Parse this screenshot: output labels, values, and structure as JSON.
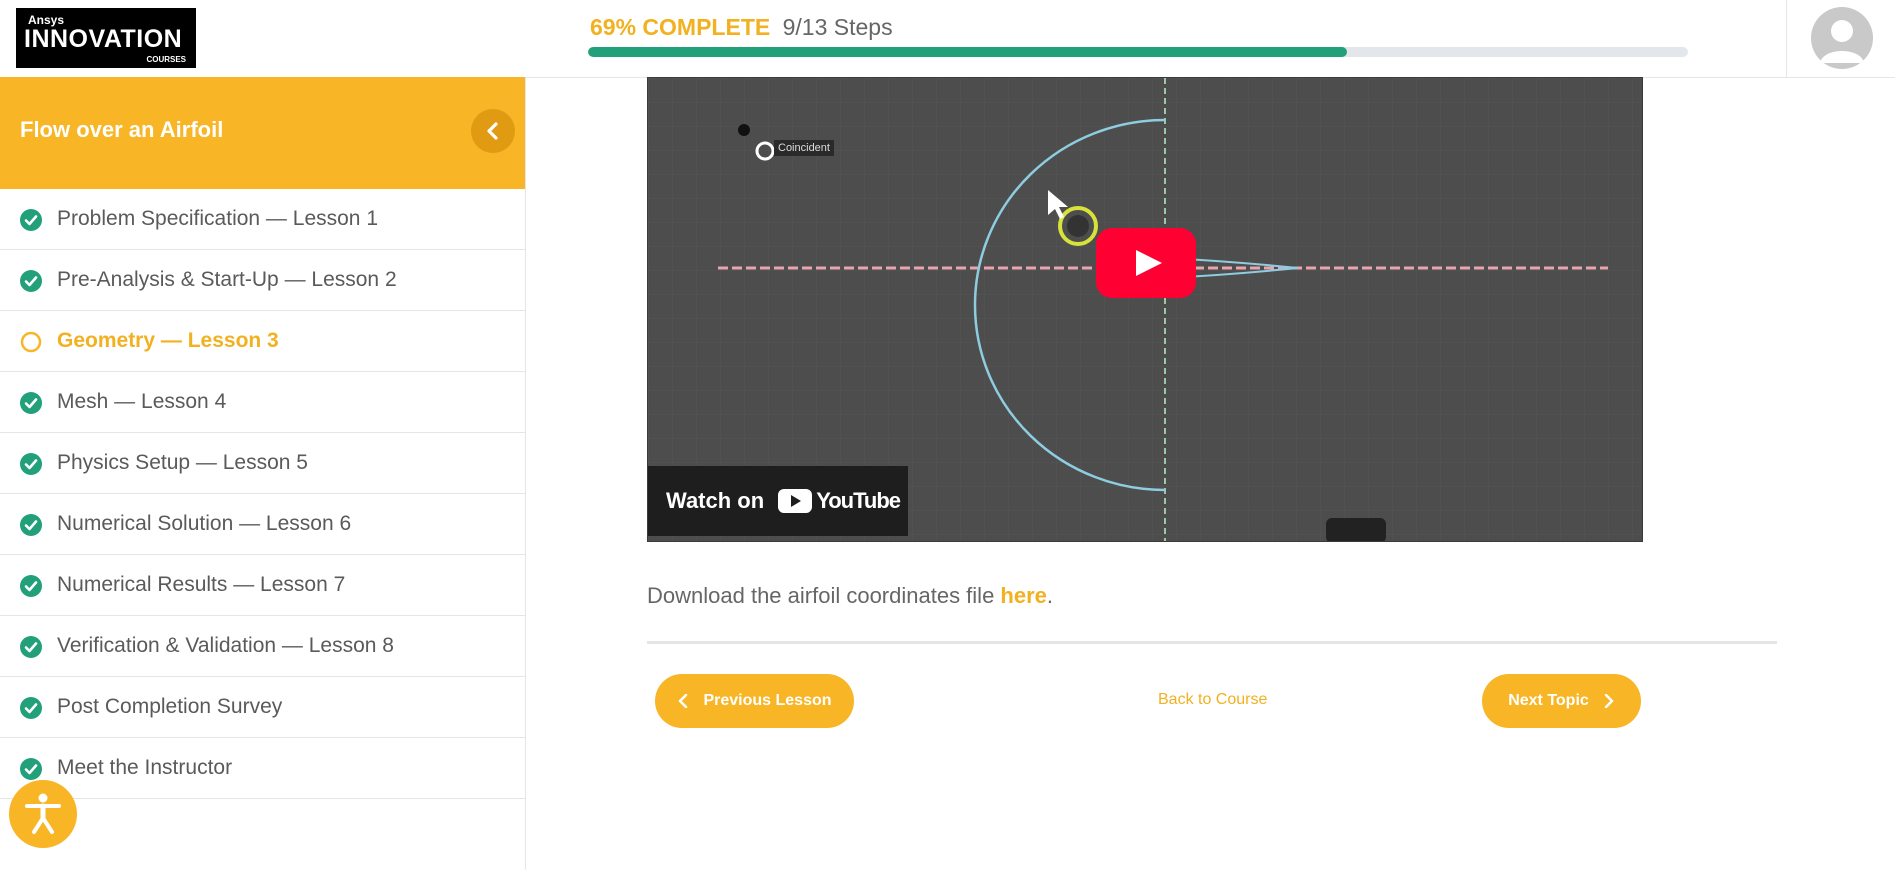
{
  "brand": {
    "line1": "Ansys",
    "line2": "INNOVATION",
    "line3": "COURSES"
  },
  "progress": {
    "percent_label": "69% COMPLETE",
    "steps_label": "9/13 Steps",
    "fraction": 0.69
  },
  "sidebar": {
    "course_title": "Flow over an Airfoil",
    "lessons": [
      {
        "label": "Problem Specification — Lesson 1",
        "status": "complete"
      },
      {
        "label": "Pre-Analysis & Start-Up — Lesson 2",
        "status": "complete"
      },
      {
        "label": "Geometry — Lesson 3",
        "status": "current"
      },
      {
        "label": "Mesh — Lesson 4",
        "status": "complete"
      },
      {
        "label": "Physics Setup — Lesson 5",
        "status": "complete"
      },
      {
        "label": "Numerical Solution — Lesson 6",
        "status": "complete"
      },
      {
        "label": "Numerical Results — Lesson 7",
        "status": "complete"
      },
      {
        "label": "Verification & Validation — Lesson 8",
        "status": "complete"
      },
      {
        "label": "Post Completion Survey",
        "status": "complete"
      },
      {
        "label": "Meet the Instructor",
        "status": "complete"
      }
    ]
  },
  "video": {
    "watch_label": "Watch on",
    "brand": "YouTube",
    "overlay_text": "Coincident"
  },
  "content": {
    "download_prefix": "Download the airfoil coordinates file ",
    "download_link": "here",
    "download_suffix": "."
  },
  "nav": {
    "prev_label": "Previous Lesson",
    "back_label": "Back to Course",
    "next_label": "Next Topic"
  },
  "colors": {
    "accent": "#f8b526",
    "accent_text": "#f2b120",
    "success": "#22a07a",
    "youtube_red": "#ff0033"
  },
  "icons": {
    "check": "check-circle-icon",
    "current": "empty-circle-icon",
    "collapse": "chevron-left-icon",
    "accessibility": "accessibility-icon",
    "play": "play-icon"
  }
}
